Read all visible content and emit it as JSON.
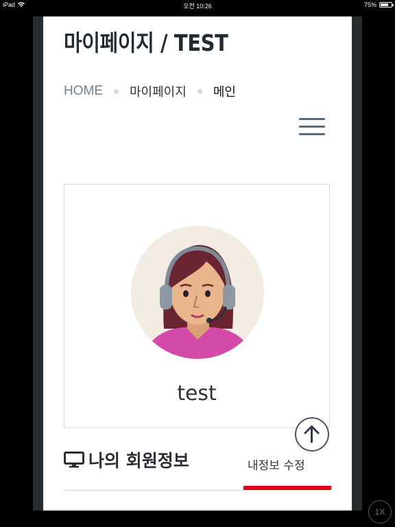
{
  "status_bar": {
    "device": "iPad",
    "time": "오전 10:26",
    "battery": "75%",
    "battery_level": 0.75
  },
  "header": {
    "title": "마이페이지 / TEST",
    "breadcrumb": {
      "home": "HOME",
      "parent": "마이페이지",
      "current": "메인"
    },
    "menu_icon": "hamburger-menu-icon"
  },
  "profile": {
    "username": "test",
    "avatar_icon": "support-agent-avatar"
  },
  "member_section": {
    "title": "나의 회원정보",
    "icon": "monitor-icon",
    "edit_label": "내정보 수정",
    "accent_color": "#e0001a"
  },
  "controls": {
    "scroll_top_icon": "arrow-up-icon",
    "speed_label": "1X"
  }
}
